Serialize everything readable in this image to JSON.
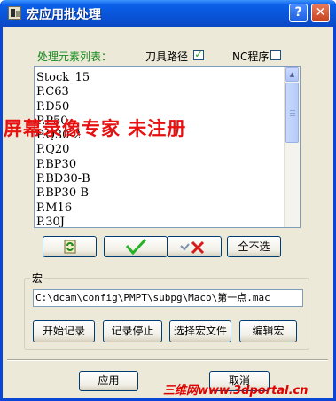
{
  "window": {
    "title": "宏应用批处理",
    "help_glyph": "?",
    "close_glyph": "✕"
  },
  "options": {
    "elements_label": "处理元素列表：",
    "toolpath_label": "刀具路径",
    "toolpath_checked": true,
    "nc_label": "NC程序",
    "nc_checked": false
  },
  "list": {
    "items": [
      "Stock_15",
      "P.C63",
      "P.D50",
      "P.P50",
      "P.Q30-2",
      "P.Q20",
      "P.BP30",
      "P.BD30-B",
      "P.BP30-B",
      "P.M16",
      "P.30J"
    ]
  },
  "watermark": "屏幕录像专家  未注册",
  "list_buttons": {
    "clear_all_label": "全不选"
  },
  "macro": {
    "group_label": "宏",
    "path": "C:\\dcam\\config\\PMPT\\subpg\\Maco\\第一点.mac",
    "start_record": "开始记录",
    "stop_record": "记录停止",
    "select_file": "选择宏文件",
    "edit": "编辑宏"
  },
  "footer": {
    "apply": "应用",
    "cancel": "取消",
    "watermark": "三维网www.3dportal.cn"
  }
}
